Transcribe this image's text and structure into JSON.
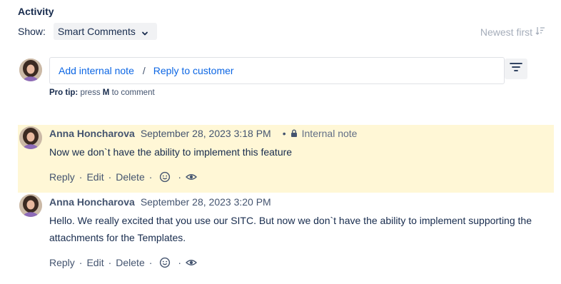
{
  "activity": {
    "heading": "Activity"
  },
  "filter": {
    "show_label": "Show:",
    "selected": "Smart Comments",
    "sort_label": "Newest first"
  },
  "composer": {
    "add_note": "Add internal note",
    "separator": "/",
    "reply": "Reply to customer"
  },
  "protip": {
    "prefix": "Pro tip:",
    "text_before": "press",
    "key": "M",
    "text_after": "to comment"
  },
  "comments": [
    {
      "author": "Anna Honcharova",
      "time": "September 28, 2023 3:18 PM",
      "dot": "•",
      "tag": "Internal note",
      "body": "Now we don`t have the ability to implement this feature",
      "actions": {
        "reply": "Reply",
        "edit": "Edit",
        "delete": "Delete",
        "sep": "·"
      }
    },
    {
      "author": "Anna Honcharova",
      "time": "September 28, 2023 3:20 PM",
      "body": "Hello. We really excited that you use our SITC. But now we don`t have the ability to implement supporting the attachments for the Templates.",
      "actions": {
        "reply": "Reply",
        "edit": "Edit",
        "delete": "Delete",
        "sep": "·"
      }
    }
  ],
  "colors": {
    "link": "#0c66e4",
    "internal_bg": "#fff7d6",
    "muted": "#44546f"
  }
}
